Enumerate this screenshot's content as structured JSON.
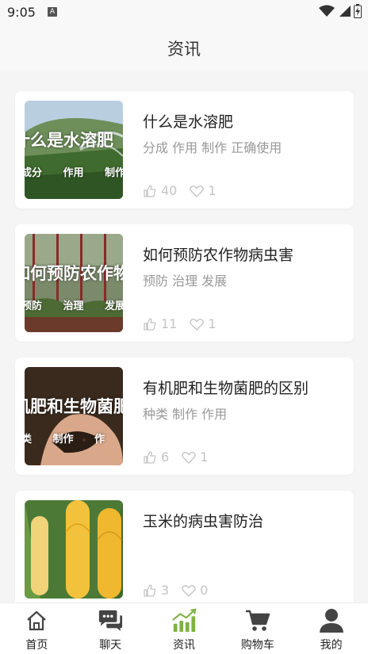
{
  "status": {
    "time": "9:05",
    "notification_badge": "A"
  },
  "header": {
    "title": "资讯"
  },
  "articles": [
    {
      "title": "什么是水溶肥",
      "tags": "分成 作用 制作 正确使用",
      "image_title": "什么是水溶肥",
      "image_tags": "成分 作用 制作",
      "likes": "40",
      "favorites": "1",
      "image": "sprinkler-field"
    },
    {
      "title": "如何预防农作物病虫害",
      "tags": "预防 治理 发展",
      "image_title": "如何预防农作物病虫",
      "image_tags": "预防 治理 发展",
      "likes": "11",
      "favorites": "1",
      "image": "greenhouse-plants"
    },
    {
      "title": "有机肥和生物菌肥的区别",
      "tags": "种类 制作 作用",
      "image_title": "机肥和生物菌肥的",
      "image_tags": "类 制作 作",
      "likes": "6",
      "favorites": "1",
      "image": "hands-soil"
    },
    {
      "title": "玉米的病虫害防治",
      "tags": "",
      "image_title": "",
      "image_tags": "",
      "likes": "3",
      "favorites": "0",
      "image": "corn-cobs"
    }
  ],
  "tabs": [
    {
      "label": "首页",
      "icon": "home-icon",
      "active": false
    },
    {
      "label": "聊天",
      "icon": "chat-icon",
      "active": false
    },
    {
      "label": "资讯",
      "icon": "chart-icon",
      "active": true
    },
    {
      "label": "购物车",
      "icon": "cart-icon",
      "active": false
    },
    {
      "label": "我的",
      "icon": "user-icon",
      "active": false
    }
  ],
  "colors": {
    "active_tab": "#7cb342",
    "icon_default": "#444444",
    "muted_text": "#999999",
    "stat_text": "#c4c4c4"
  }
}
